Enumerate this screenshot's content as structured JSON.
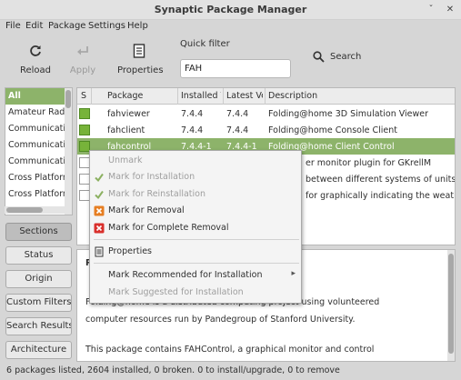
{
  "window": {
    "title": "Synaptic Package Manager",
    "minimize": "ˇ",
    "close": "✕"
  },
  "menubar": [
    "File",
    "Edit",
    "Package",
    "Settings",
    "Help"
  ],
  "toolbar": {
    "reload": "Reload",
    "apply": "Apply",
    "properties": "Properties",
    "quick_filter_label": "Quick filter",
    "quick_filter_value": "FAH",
    "search": "Search"
  },
  "sections": {
    "items": [
      "All",
      "Amateur Radio",
      "Communication",
      "Communication",
      "Communication",
      "Cross Platform",
      "Cross Platform"
    ],
    "selected": 0
  },
  "side_buttons": [
    "Sections",
    "Status",
    "Origin",
    "Custom Filters",
    "Search Results",
    "Architecture"
  ],
  "table": {
    "columns": [
      "S",
      "Package",
      "Installed V",
      "Latest Ve",
      "Description"
    ],
    "rows": [
      {
        "package": "fahviewer",
        "installed": "7.4.4",
        "latest": "7.4.4",
        "description": "Folding@home 3D Simulation Viewer",
        "status": "installed"
      },
      {
        "package": "fahclient",
        "installed": "7.4.4",
        "latest": "7.4.4",
        "description": "Folding@home Console Client",
        "status": "installed"
      },
      {
        "package": "fahcontrol",
        "installed": "7.4.4-1",
        "latest": "7.4.4-1",
        "description": "Folding@home Client Control",
        "status": "installed"
      },
      {
        "package": "",
        "installed": "",
        "latest": "",
        "description": "er monitor plugin for GKrellM",
        "status": "none"
      },
      {
        "package": "",
        "installed": "",
        "latest": "",
        "description": "between different systems of units",
        "status": "none"
      },
      {
        "package": "",
        "installed": "",
        "latest": "",
        "description": "for graphically indicating the weather",
        "status": "none"
      }
    ],
    "selected": 2
  },
  "context_menu": {
    "unmark": "Unmark",
    "mark_install": "Mark for Installation",
    "mark_reinstall": "Mark for Reinstallation",
    "mark_removal": "Mark for Removal",
    "mark_complete_removal": "Mark for Complete Removal",
    "properties": "Properties",
    "mark_recommended": "Mark Recommended for Installation",
    "mark_suggested": "Mark Suggested for Installation",
    "submenu_arrow": "▸"
  },
  "detail": {
    "heading_fragment": "P",
    "line1": "Folding@home is a distributed computing project using volunteered",
    "line2": "computer resources run by Pandegroup of Stanford University.",
    "line3": "This package contains FAHControl, a graphical monitor and control"
  },
  "status_text": "6 packages listed, 2604 installed, 0 broken. 0 to install/upgrade, 0 to remove",
  "colors": {
    "selection": "#8db36a",
    "installed_box": "#77b33a",
    "removal_orange": "#e67e22",
    "removal_red": "#d9302c"
  }
}
